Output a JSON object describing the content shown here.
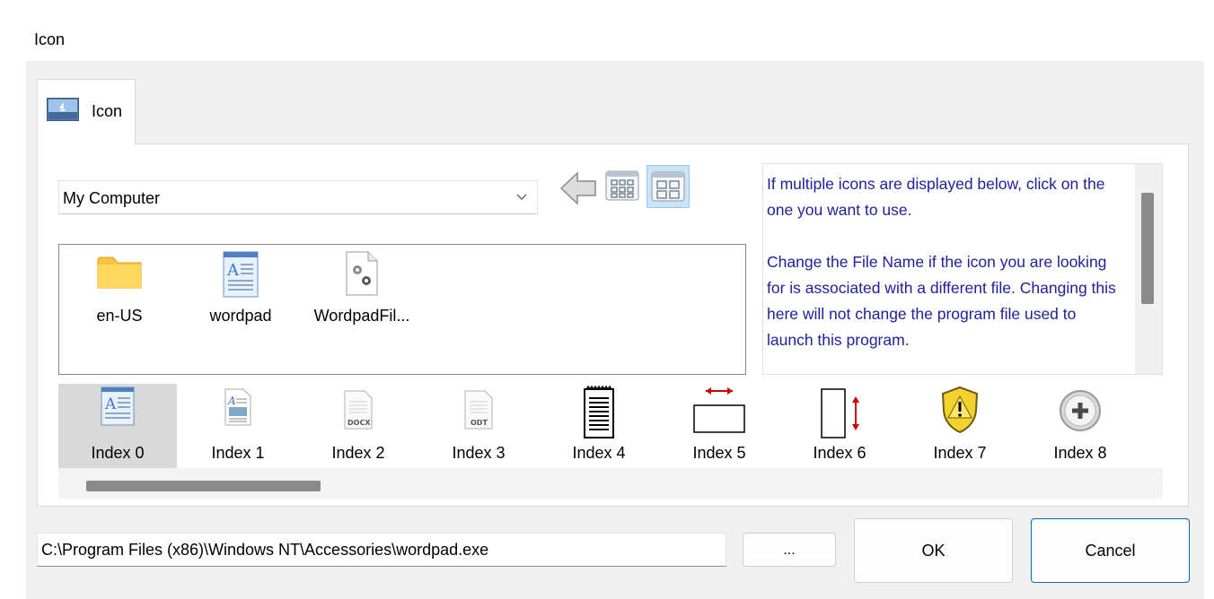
{
  "window": {
    "title": "Icon"
  },
  "tab": {
    "label": "Icon",
    "icon": "image-icon"
  },
  "location": {
    "value": "My Computer",
    "icon": "chevron-down-icon"
  },
  "toolbar": {
    "back_icon": "back-arrow-icon",
    "small_view_icon": "small-icons-view-icon",
    "large_view_icon": "large-icons-view-icon"
  },
  "files": [
    {
      "label": "en-US",
      "icon": "folder-icon"
    },
    {
      "label": "wordpad",
      "icon": "wordpad-icon"
    },
    {
      "label": "WordpadFil...",
      "icon": "settings-file-icon"
    }
  ],
  "info": {
    "text": "If multiple icons are displayed below, click on the one you want to use.\n\nChange the File Name if the icon you are looking for is associated with a different file. Changing this here will not change the program file used to launch this program."
  },
  "icons": [
    {
      "label": "Index 0",
      "icon": "wordpad-icon",
      "selected": true
    },
    {
      "label": "Index 1",
      "icon": "rich-document-icon"
    },
    {
      "label": "Index 2",
      "icon": "docx-file-icon"
    },
    {
      "label": "Index 3",
      "icon": "odt-file-icon"
    },
    {
      "label": "Index 4",
      "icon": "notepad-icon"
    },
    {
      "label": "Index 5",
      "icon": "page-width-icon"
    },
    {
      "label": "Index 6",
      "icon": "page-height-icon"
    },
    {
      "label": "Index 7",
      "icon": "warning-shield-icon"
    },
    {
      "label": "Index 8",
      "icon": "add-circle-icon"
    }
  ],
  "file_name": {
    "value": "C:\\Program Files (x86)\\Windows NT\\Accessories\\wordpad.exe"
  },
  "buttons": {
    "browse": "...",
    "ok": "OK",
    "cancel": "Cancel"
  },
  "colors": {
    "info_text": "#1f1f9a",
    "accent": "#0067c0",
    "selected_bg": "#d9d9d9"
  }
}
